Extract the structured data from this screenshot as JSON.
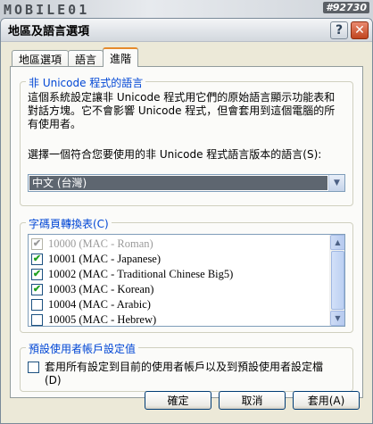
{
  "watermark": {
    "brand": "MOBILE01",
    "post_id": "#92730"
  },
  "window": {
    "title": "地區及語言選項",
    "help_glyph": "?",
    "close_glyph": "✕"
  },
  "tabs": [
    {
      "label": "地區選項",
      "active": false
    },
    {
      "label": "語言",
      "active": false
    },
    {
      "label": "進階",
      "active": true
    }
  ],
  "non_unicode": {
    "legend": "非 Unicode 程式的語言",
    "description": "這個系統設定讓非 Unicode 程式用它們的原始語言顯示功能表和對話方塊。它不會影響 Unicode 程式，但會套用到這個電腦的所有使用者。",
    "select_label": "選擇一個符合您要使用的非 Unicode 程式語言版本的語言(S):",
    "selected_language": "中文 (台灣)"
  },
  "code_pages": {
    "legend": "字碼頁轉換表(C)",
    "items": [
      {
        "label": "10000 (MAC - Roman)",
        "checked": true,
        "disabled": true
      },
      {
        "label": "10001 (MAC - Japanese)",
        "checked": true,
        "disabled": false
      },
      {
        "label": "10002 (MAC - Traditional Chinese Big5)",
        "checked": true,
        "disabled": false
      },
      {
        "label": "10003 (MAC - Korean)",
        "checked": true,
        "disabled": false
      },
      {
        "label": "10004 (MAC - Arabic)",
        "checked": false,
        "disabled": false
      },
      {
        "label": "10005 (MAC - Hebrew)",
        "checked": false,
        "disabled": false
      }
    ]
  },
  "default_user": {
    "legend": "預設使用者帳戶設定值",
    "checkbox_label": "套用所有設定到目前的使用者帳戶以及到預設使用者設定檔(D)",
    "checked": false
  },
  "buttons": {
    "ok": "確定",
    "cancel": "取消",
    "apply": "套用(A)"
  },
  "icons": {
    "check": "✔",
    "arrow_down": "▼",
    "arrow_up": "▲"
  }
}
